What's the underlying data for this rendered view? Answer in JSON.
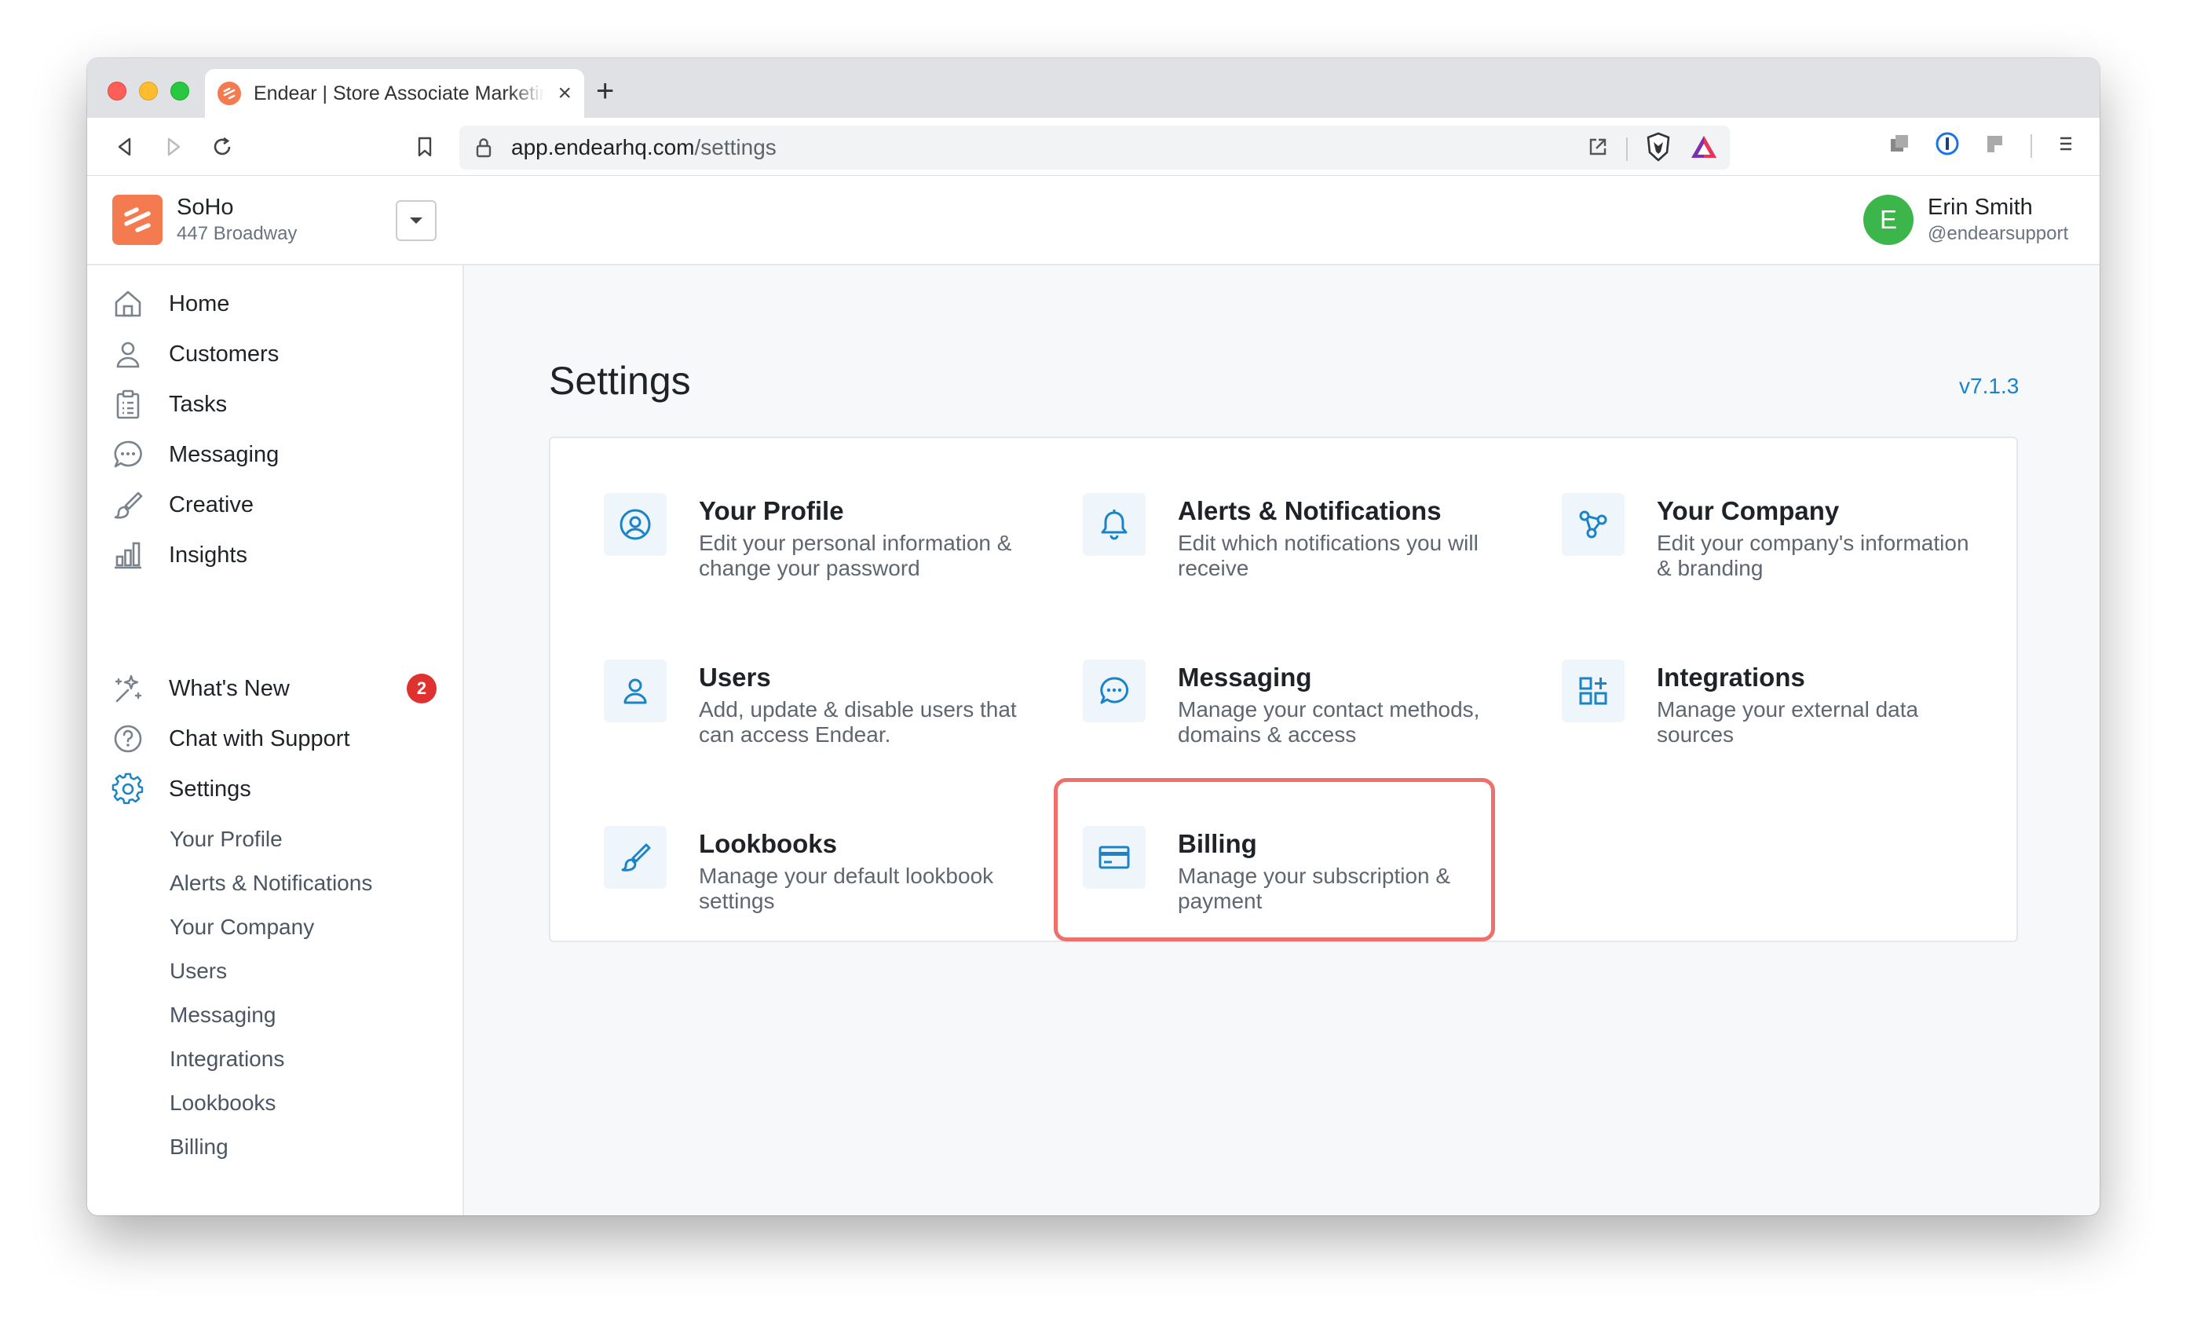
{
  "browser": {
    "tab_title": "Endear | Store Associate Marketing",
    "tab_close": "×",
    "new_tab": "+",
    "url_domain": "app.endearhq.com",
    "url_path": "/settings"
  },
  "header": {
    "store_name": "SoHo",
    "store_address": "447 Broadway",
    "user_initial": "E",
    "user_name": "Erin Smith",
    "user_handle": "@endearsupport"
  },
  "sidebar": {
    "nav": [
      {
        "label": "Home",
        "icon": "home-icon"
      },
      {
        "label": "Customers",
        "icon": "user-icon"
      },
      {
        "label": "Tasks",
        "icon": "clipboard-icon"
      },
      {
        "label": "Messaging",
        "icon": "chat-icon"
      },
      {
        "label": "Creative",
        "icon": "brush-icon"
      },
      {
        "label": "Insights",
        "icon": "bar-chart-icon"
      }
    ],
    "secondary": [
      {
        "label": "What's New",
        "icon": "sparkle-icon",
        "badge": "2"
      },
      {
        "label": "Chat with Support",
        "icon": "help-icon"
      },
      {
        "label": "Settings",
        "icon": "gear-icon",
        "active": true
      }
    ],
    "settings_sub": [
      "Your Profile",
      "Alerts & Notifications",
      "Your Company",
      "Users",
      "Messaging",
      "Integrations",
      "Lookbooks",
      "Billing"
    ]
  },
  "main": {
    "title": "Settings",
    "version": "v7.1.3",
    "items": [
      {
        "title": "Your Profile",
        "desc": "Edit your personal information & change your password",
        "icon": "profile-circle-icon"
      },
      {
        "title": "Alerts & Notifications",
        "desc": "Edit which notifications you will receive",
        "icon": "bell-icon"
      },
      {
        "title": "Your Company",
        "desc": "Edit your company's information & branding",
        "icon": "share-nodes-icon"
      },
      {
        "title": "Users",
        "desc": "Add, update & disable users that can access Endear.",
        "icon": "user-icon"
      },
      {
        "title": "Messaging",
        "desc": "Manage your contact methods, domains & access",
        "icon": "chat-icon"
      },
      {
        "title": "Integrations",
        "desc": "Manage your external data sources",
        "icon": "apps-add-icon"
      },
      {
        "title": "Lookbooks",
        "desc": "Manage your default lookbook settings",
        "icon": "brush-icon"
      },
      {
        "title": "Billing",
        "desc": "Manage your subscription & payment",
        "icon": "credit-card-icon",
        "highlighted": true
      }
    ]
  },
  "colors": {
    "accent": "#1b83c8",
    "brand": "#f47a4f",
    "highlight": "#f06f6a",
    "badge": "#e03131",
    "avatar": "#3cb54a"
  }
}
